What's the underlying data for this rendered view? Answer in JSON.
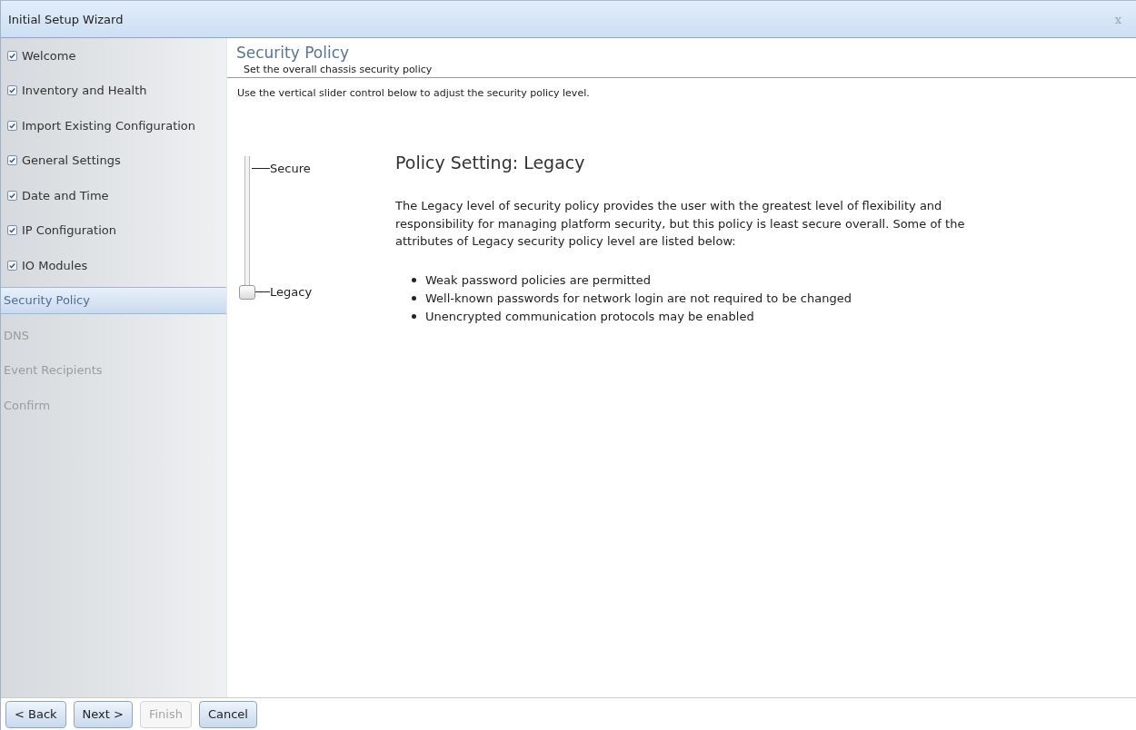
{
  "window": {
    "title": "Initial Setup Wizard",
    "close": "x"
  },
  "steps": [
    {
      "label": "Welcome",
      "completed": true,
      "selected": false
    },
    {
      "label": "Inventory and Health",
      "completed": true,
      "selected": false
    },
    {
      "label": "Import Existing Configuration",
      "completed": true,
      "selected": false
    },
    {
      "label": "General Settings",
      "completed": true,
      "selected": false
    },
    {
      "label": "Date and Time",
      "completed": true,
      "selected": false
    },
    {
      "label": "IP Configuration",
      "completed": true,
      "selected": false
    },
    {
      "label": "IO Modules",
      "completed": true,
      "selected": false
    },
    {
      "label": "Security Policy",
      "completed": false,
      "selected": true
    },
    {
      "label": "DNS",
      "completed": false,
      "selected": false
    },
    {
      "label": "Event Recipients",
      "completed": false,
      "selected": false
    },
    {
      "label": "Confirm",
      "completed": false,
      "selected": false
    }
  ],
  "page": {
    "title": "Security Policy",
    "subtitle": "Set the overall chassis security policy",
    "instruction": "Use the vertical slider control below to adjust the security policy level."
  },
  "slider": {
    "top_label": "Secure",
    "bottom_label": "Legacy",
    "level": 0
  },
  "policy": {
    "heading": "Policy Setting: Legacy",
    "description": "The Legacy level of security policy provides the user with the greatest level of flexibility and responsibility for managing platform security, but this policy is least secure overall. Some of the attributes of Legacy security policy level are listed below:",
    "attributes": [
      "Weak password policies are permitted",
      "Well-known passwords for network login are not required to be changed",
      "Unencrypted communication protocols may be enabled"
    ]
  },
  "buttons": [
    {
      "label": "< Back",
      "disabled": false
    },
    {
      "label": "Next >",
      "disabled": false
    },
    {
      "label": "Finish",
      "disabled": true
    },
    {
      "label": "Cancel",
      "disabled": false
    }
  ]
}
